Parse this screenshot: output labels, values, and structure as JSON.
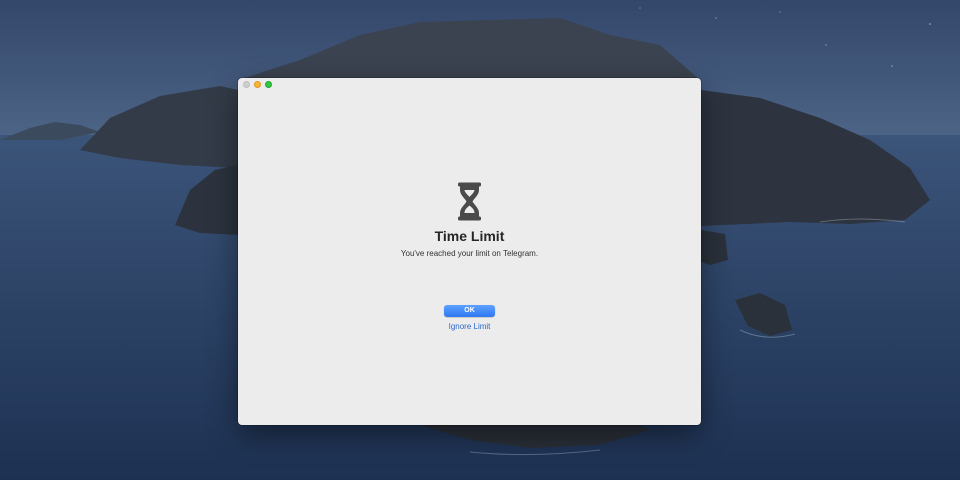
{
  "dialog": {
    "icon": "hourglass-icon",
    "title": "Time Limit",
    "message": "You've reached your limit on Telegram.",
    "ok_label": "OK",
    "ignore_label": "Ignore Limit"
  },
  "window_controls": [
    "close",
    "minimize",
    "zoom"
  ],
  "colors": {
    "window_bg": "#ececec",
    "accent": "#2f78f0",
    "link": "#2f67c9",
    "close": "#cfcfcf",
    "minimize": "#f7b532",
    "zoom": "#2fc840"
  }
}
